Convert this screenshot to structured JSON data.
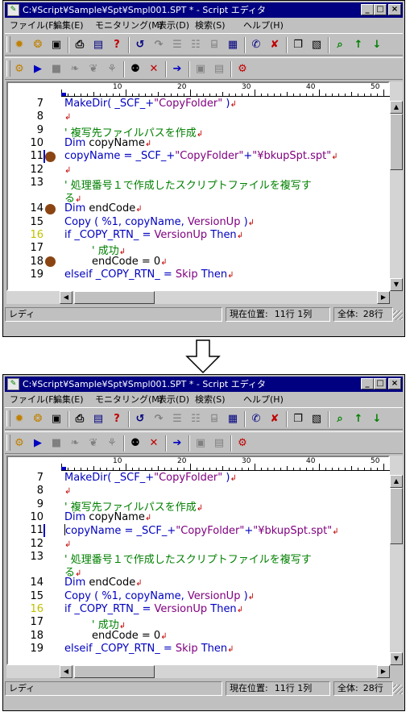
{
  "window": {
    "title": "C:¥Script¥Sample¥Spt¥Smpl001.SPT * - Script エディタ",
    "controls": {
      "minimize": "_",
      "maximize": "□",
      "close": "×"
    }
  },
  "menu": [
    "ファイル(F)",
    "編集(E)",
    "モニタリング(M)",
    "表示(D)",
    "検索(S)",
    "ヘルプ(H)"
  ],
  "toolbar1_icons": [
    "new-file-icon",
    "open-folder-icon",
    "save-icon",
    "print-icon",
    "book-icon",
    "help-icon",
    "undo-icon",
    "redo-icon",
    "cut-icon",
    "copy-icon",
    "paste-icon",
    "toggle-icon",
    "find-icon",
    "find-clear-icon",
    "binoculars-icon",
    "replace-icon",
    "zoom-icon",
    "next-icon",
    "prev-icon"
  ],
  "toolbar1_glyphs": [
    "✹",
    "❂",
    "▣",
    "⎙",
    "▤",
    "?",
    "↺",
    "↷",
    "☰",
    "☷",
    "⌸",
    "▦",
    "✆",
    "✘",
    "❐",
    "▧",
    "⌕",
    "↑",
    "↓"
  ],
  "toolbar2_icons": [
    "run-script-icon",
    "play-icon",
    "stop-icon",
    "step-icon",
    "step-into-icon",
    "step-out-icon",
    "breakpoint-icon",
    "breakpoint-clear-icon",
    "run-to-cursor-icon",
    "watch-icon",
    "variables-icon",
    "monitor-icon"
  ],
  "toolbar2_glyphs": [
    "⚙",
    "▶",
    "■",
    "❧",
    "❦",
    "⚘",
    "⚉",
    "✕",
    "➔",
    "▣",
    "▤",
    "⚙"
  ],
  "ruler_labels": [
    "10",
    "20",
    "30",
    "40",
    "50"
  ],
  "line_numbers": [
    "7",
    "8",
    "9",
    "10",
    "11",
    "12",
    "13",
    "",
    "14",
    "15",
    "16",
    "17",
    "18",
    "19"
  ],
  "code_lines_html_note": "",
  "code": {
    "l7": {
      "a": "MakeDir( _SCF_+",
      "b": "\"CopyFolder\"",
      "c": " )"
    },
    "l9": "' 複写先ファイルパスを作成",
    "l10": {
      "a": "Dim",
      "b": " copyName"
    },
    "l11": {
      "a": "copyName = _SCF_+",
      "b": "\"CopyFolder\"",
      "c": "+",
      "d": "\"¥bkupSpt.spt\""
    },
    "l13a": "' 処理番号１で作成したスクリプトファイルを複写す",
    "l13b": "る",
    "l14": {
      "a": "Dim",
      "b": " endCode"
    },
    "l15": {
      "a": "Copy ( %1, copyName, ",
      "b": "VersionUp",
      "c": " )"
    },
    "l16": {
      "a": "if _COPY_RTN_ = ",
      "b": "VersionUp",
      "c": " Then"
    },
    "l17": "' 成功",
    "l18": "endCode = 0",
    "l19": {
      "a": "elseif _COPY_RTN_ = ",
      "b": "Skip",
      "c": " Then"
    },
    "return_mark": "↲"
  },
  "status": {
    "left": "レディ",
    "pos_label": "現在位置:",
    "pos_value": "11行 1列",
    "total_label": "全体:",
    "total_value": "28行"
  },
  "colors": {
    "keyword": "#0000c0",
    "string": "#800080",
    "comment": "#008000",
    "breakpoint": "#8b4513",
    "titlebar": "#000080"
  }
}
